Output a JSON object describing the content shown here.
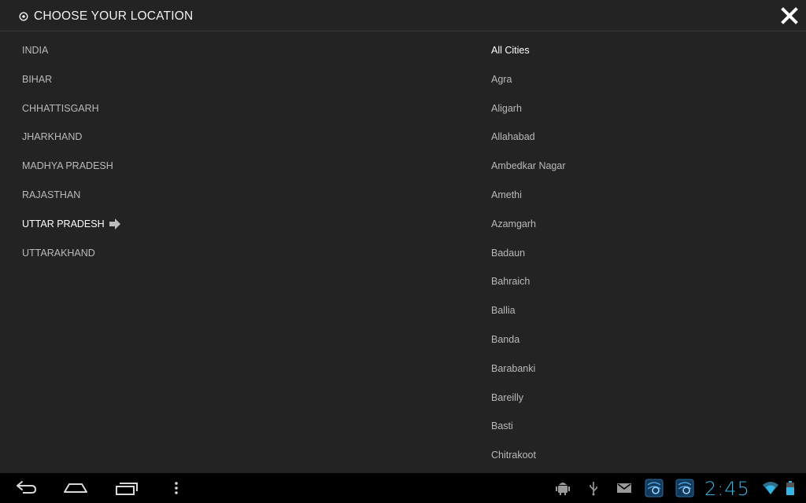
{
  "header": {
    "title": "CHOOSE YOUR LOCATION"
  },
  "states": [
    {
      "label": "INDIA",
      "active": false
    },
    {
      "label": "BIHAR",
      "active": false
    },
    {
      "label": "CHHATTISGARH",
      "active": false
    },
    {
      "label": "JHARKHAND",
      "active": false
    },
    {
      "label": "MADHYA PRADESH",
      "active": false
    },
    {
      "label": "RAJASTHAN",
      "active": false
    },
    {
      "label": "UTTAR PRADESH",
      "active": true
    },
    {
      "label": "UTTARAKHAND",
      "active": false
    }
  ],
  "cities": [
    {
      "label": "All Cities",
      "active": true
    },
    {
      "label": "Agra",
      "active": false
    },
    {
      "label": "Aligarh",
      "active": false
    },
    {
      "label": "Allahabad",
      "active": false
    },
    {
      "label": "Ambedkar Nagar",
      "active": false
    },
    {
      "label": "Amethi",
      "active": false
    },
    {
      "label": "Azamgarh",
      "active": false
    },
    {
      "label": "Badaun",
      "active": false
    },
    {
      "label": "Bahraich",
      "active": false
    },
    {
      "label": "Ballia",
      "active": false
    },
    {
      "label": "Banda",
      "active": false
    },
    {
      "label": "Barabanki",
      "active": false
    },
    {
      "label": "Bareilly",
      "active": false
    },
    {
      "label": "Basti",
      "active": false
    },
    {
      "label": "Chitrakoot",
      "active": false
    }
  ],
  "status_bar": {
    "time": "2:45"
  },
  "colors": {
    "background": "#232323",
    "text_inactive": "#b9b9b9",
    "text_active": "#ffffff",
    "clock_accent": "#33b5e5"
  }
}
